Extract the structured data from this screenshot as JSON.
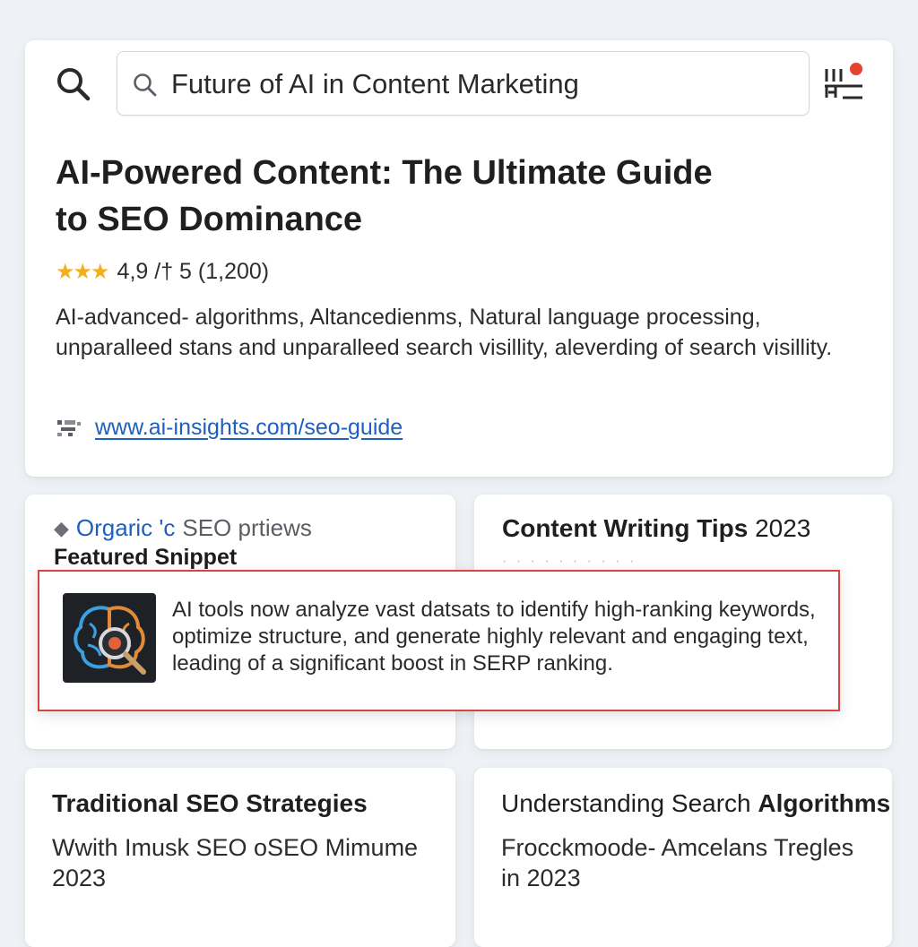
{
  "search": {
    "query": "Future of AI in Content Marketing"
  },
  "result": {
    "title": "AI-Powered Content: The Ultimate Guide to SEO Dominance",
    "rating_value": 4.9,
    "rating_text": "4,9 /† 5 (1,200)",
    "description": "AI-advanced- algorithms, Altancedienms, Natural language processing, unparalleed stans and unparalleed search visillity, aleverding of search visillity.",
    "url": "www.ai-insights.com/seo-guide"
  },
  "organic_card": {
    "label_a": "Orgaric 'c",
    "label_b": "SEO prtiews",
    "featured_label": "Featured Snippet"
  },
  "tips_card": {
    "title": "Content Writing Tips",
    "year": "2023"
  },
  "snippet": {
    "text": "AI tools now analyze vast datsats to identify high-ranking keywords, optimize structure, and generate highly relevant and engaging text, leading of a significant boost in SERP ranking.",
    "thumbnail_icon": "brain-magnifier-icon"
  },
  "traditional_card": {
    "title": "Traditional SEO Strategies",
    "subtitle": "Wwith Imusk SEO oSEO Mimume 2023"
  },
  "algorithms_card": {
    "title_a": "Understanding Search",
    "title_b": "Algorithms",
    "subtitle": "Frocckmoode- Amcelans Tregles in 2023"
  },
  "colors": {
    "accent_link": "#1f5fbf",
    "star": "#f2b01e",
    "notification_dot": "#e8412e",
    "snippet_border": "#d94341",
    "background": "#eef1f5"
  }
}
